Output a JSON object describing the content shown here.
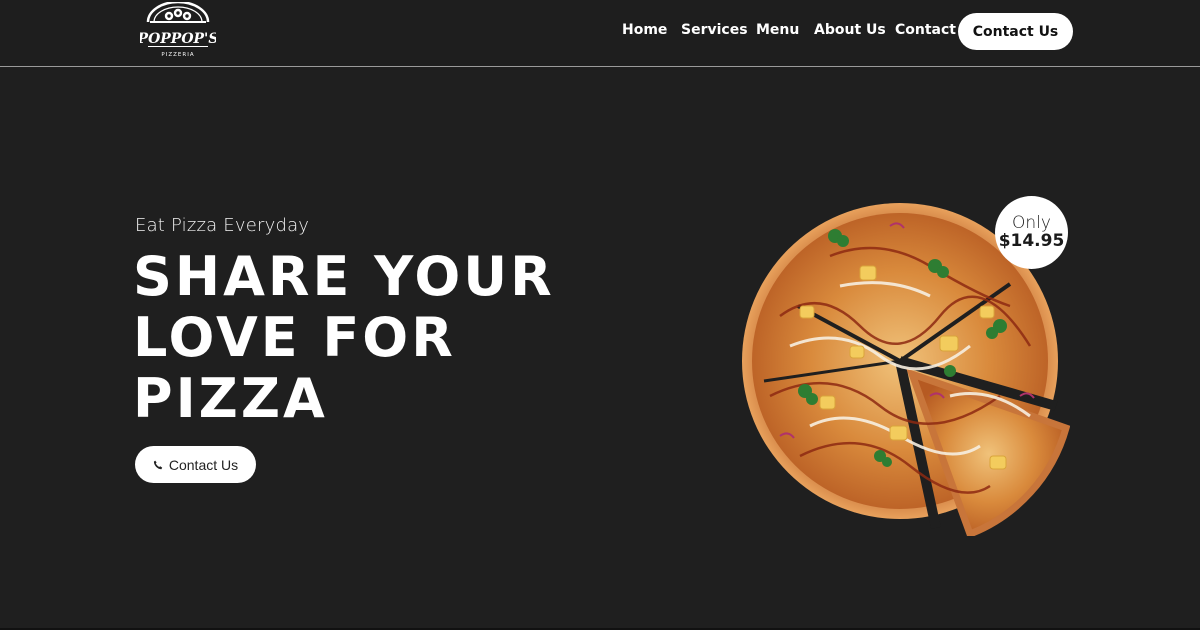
{
  "brand": {
    "name": "POPPOP'S",
    "tagline": "PIZZERIA"
  },
  "nav": {
    "links": [
      {
        "label": "Home"
      },
      {
        "label": "Services"
      },
      {
        "label": "Menu"
      },
      {
        "label": "About Us"
      },
      {
        "label": "Contact"
      }
    ],
    "cta_label": "Contact Us"
  },
  "hero": {
    "subtitle": "Eat Pizza Everyday",
    "title_lines": [
      "SHARE YOUR",
      "LOVE FOR",
      "PIZZA"
    ],
    "button_label": "Contact Us",
    "button_icon": "phone-icon"
  },
  "promo": {
    "prefix": "Only",
    "price": "$14.95"
  },
  "colors": {
    "background": "#1f1f1f",
    "text": "#ffffff",
    "button_bg": "#ffffff",
    "button_text": "#111111"
  }
}
